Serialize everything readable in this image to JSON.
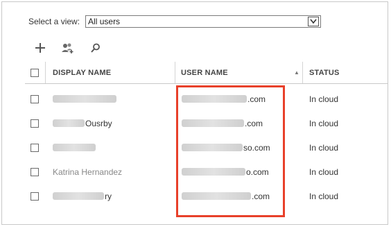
{
  "view_selector": {
    "label": "Select a view:",
    "selected": "All users"
  },
  "toolbar": {
    "icons": [
      "add-icon",
      "add-group-icon",
      "search-icon"
    ]
  },
  "table": {
    "columns": [
      "DISPLAY NAME",
      "USER NAME",
      "STATUS"
    ],
    "sort_indicator": "▲",
    "rows": [
      {
        "display_name_visible": "",
        "user_name_visible": ".com",
        "status": "In cloud"
      },
      {
        "display_name_visible": "Ousrby",
        "user_name_visible": ".com",
        "status": "In cloud"
      },
      {
        "display_name_visible": "",
        "user_name_visible": "so.com",
        "status": "In cloud"
      },
      {
        "display_name_visible": "Katrina Hernandez",
        "user_name_visible": "o.com",
        "status": "In cloud"
      },
      {
        "display_name_visible": "ry",
        "user_name_visible": ".com",
        "status": "In cloud"
      }
    ]
  },
  "colors": {
    "highlight_border": "#e8402a",
    "grid_line": "#c8c8c8"
  }
}
